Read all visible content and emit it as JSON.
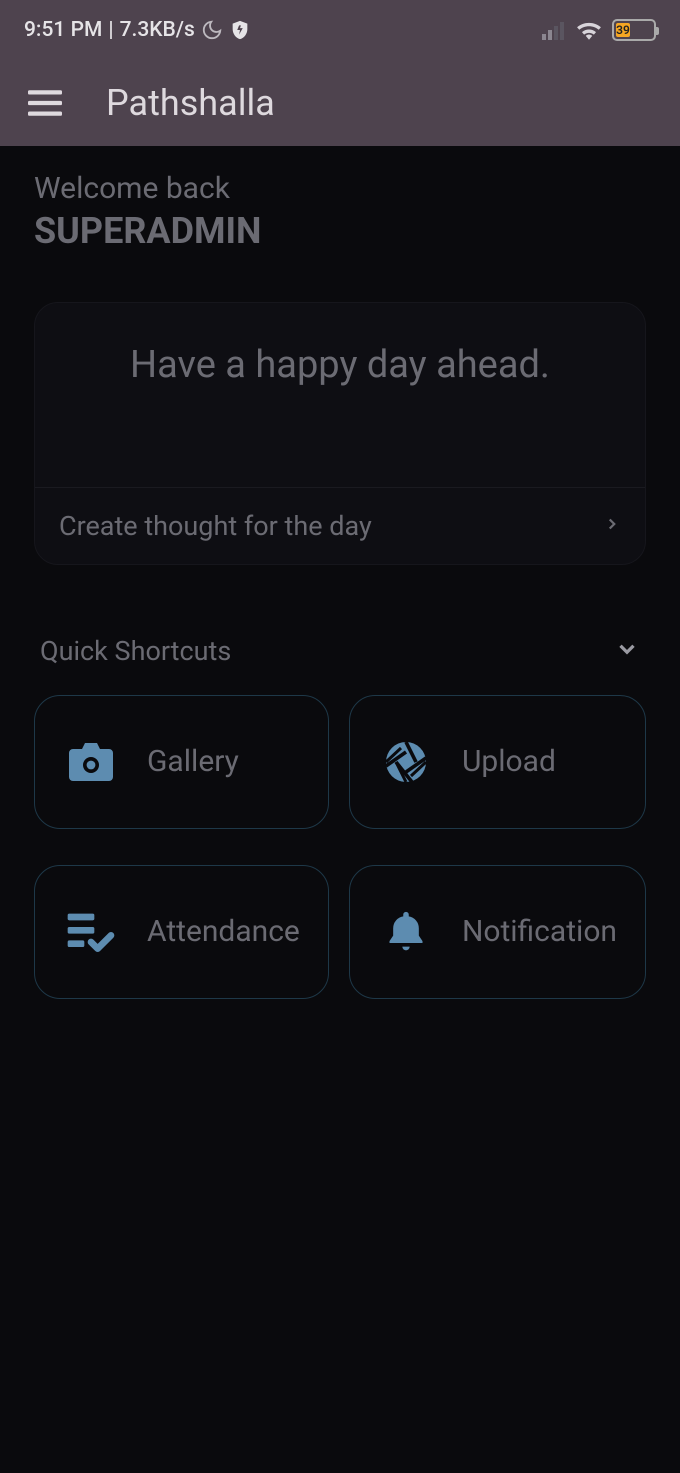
{
  "status": {
    "time": "9:51 PM",
    "speed": "7.3KB/s",
    "battery_pct": "39"
  },
  "app": {
    "title": "Pathshalla"
  },
  "welcome": {
    "greeting": "Welcome back",
    "username": "SUPERADMIN"
  },
  "thought": {
    "text": "Have a happy day ahead.",
    "create_label": "Create thought for the day"
  },
  "shortcuts": {
    "title": "Quick Shortcuts",
    "items": [
      {
        "icon": "camera",
        "label": "Gallery"
      },
      {
        "icon": "aperture",
        "label": "Upload"
      },
      {
        "icon": "checklist",
        "label": "Attendance"
      },
      {
        "icon": "bell",
        "label": "Notification"
      }
    ]
  },
  "colors": {
    "accent": "#5d8cb0",
    "muted": "#6b6b73",
    "barBg": "#4e434e"
  }
}
